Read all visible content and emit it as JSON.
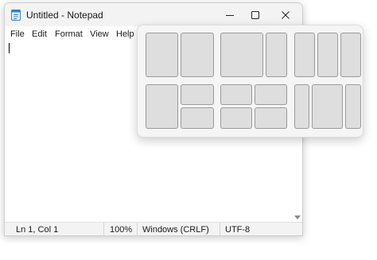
{
  "window": {
    "title": "Untitled - Notepad",
    "icons": {
      "app": "notepad-icon",
      "minimize": "minimize-icon",
      "maximize": "maximize-icon",
      "close": "close-icon"
    }
  },
  "menu": [
    "File",
    "Edit",
    "Format",
    "View",
    "Help"
  ],
  "editor": {
    "content": ""
  },
  "status": {
    "position": "Ln 1, Col 1",
    "zoom": "100%",
    "line_endings": "Windows (CRLF)",
    "encoding": "UTF-8"
  },
  "snap_layouts": {
    "layouts": [
      {
        "name": "two-columns-equal",
        "zones": 2
      },
      {
        "name": "two-columns-wide-narrow",
        "zones": 2
      },
      {
        "name": "three-columns",
        "zones": 3
      },
      {
        "name": "left-column-right-split",
        "zones": 3
      },
      {
        "name": "four-quadrants",
        "zones": 4
      },
      {
        "name": "three-columns-wide-center",
        "zones": 3
      }
    ]
  }
}
